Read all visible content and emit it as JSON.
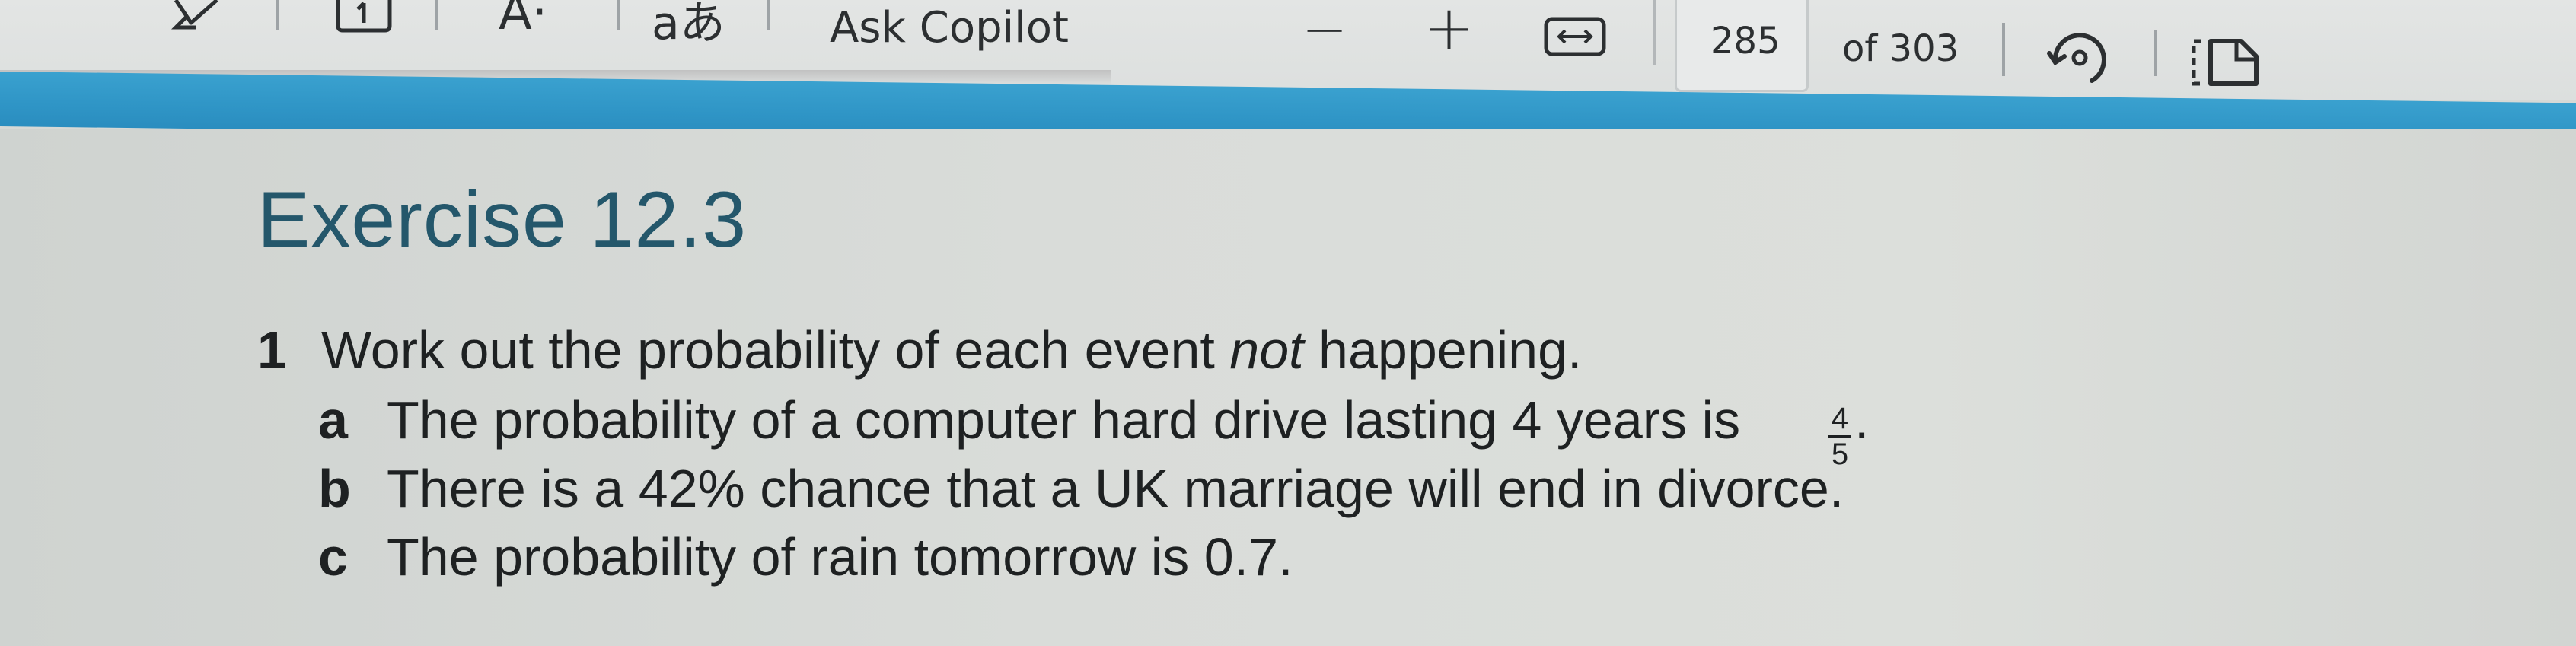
{
  "toolbar": {
    "read_aloud_letter": "A·",
    "translate_glyph": "aあ",
    "ask_copilot_label": "Ask Copilot",
    "zoom_out_symbol": "−",
    "zoom_in_symbol": "+",
    "current_page": "285",
    "page_total": "of 303",
    "icons": [
      "draw-icon",
      "page-view-icon",
      "read-aloud-icon",
      "translate-icon",
      "fit-width-icon",
      "rotate-icon",
      "two-page-view-icon"
    ]
  },
  "document": {
    "title": "Exercise 12.3",
    "question": {
      "number": "1",
      "text_before": "Work out the probability of each event ",
      "text_emphasis": "not",
      "text_after": " happening.",
      "parts": [
        {
          "letter": "a",
          "text": "The probability of a computer hard drive lasting 4 years is",
          "fraction_numerator": "4",
          "fraction_denominator": "5",
          "end": "."
        },
        {
          "letter": "b",
          "text": "There is a 42% chance that a UK marriage will end in divorce."
        },
        {
          "letter": "c",
          "text": "The probability of rain tomorrow is 0.7."
        }
      ]
    }
  },
  "colors": {
    "title_color": "#24576b",
    "accent_band": "#2f95c6",
    "text_color": "#1e2122"
  }
}
